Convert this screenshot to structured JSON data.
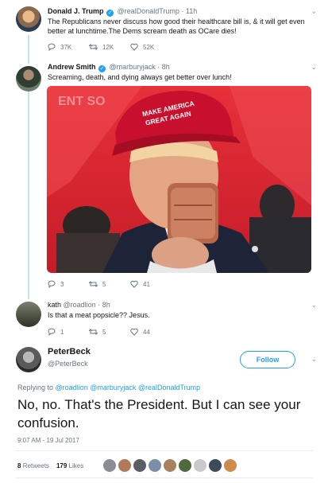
{
  "tweet1": {
    "name": "Donald J. Trump",
    "handle": "@realDonaldTrump",
    "time": "11h",
    "text": "The Republicans never discuss how good their healthcare bill is, & it will get even better at lunchtime.The Dems scream death as OCare dies!",
    "replies": "37K",
    "retweets": "12K",
    "likes": "52K"
  },
  "tweet2": {
    "name": "Andrew Smith",
    "handle": "@marburyjack",
    "time": "8h",
    "text": "Screaming, death, and dying always get better over lunch!",
    "hat_text": "MAKE AMERICA GREAT AGAIN",
    "replies": "3",
    "retweets": "5",
    "likes": "41"
  },
  "tweet3": {
    "name": "kath",
    "handle": "@roadlion",
    "time": "8h",
    "text": "Is that a meat popsicle?? Jesus.",
    "replies": "1",
    "retweets": "5",
    "likes": "44"
  },
  "main": {
    "name": "PeterBeck",
    "handle": "@PeterBeck",
    "follow_label": "Follow",
    "replying_prefix": "Replying to",
    "replying_handles": "@roadlion @marburyjack @realDonaldTrump",
    "text": "No, no. That's the President. But I can see your confusion.",
    "timestamp": "9:07 AM - 19 Jul 2017",
    "retweets_count": "8",
    "retweets_label": "Retweets",
    "likes_count": "179",
    "likes_label": "Likes"
  },
  "colors": {
    "accent": "#1da1f2",
    "muted": "#657786",
    "hat_red": "#c8102e"
  }
}
